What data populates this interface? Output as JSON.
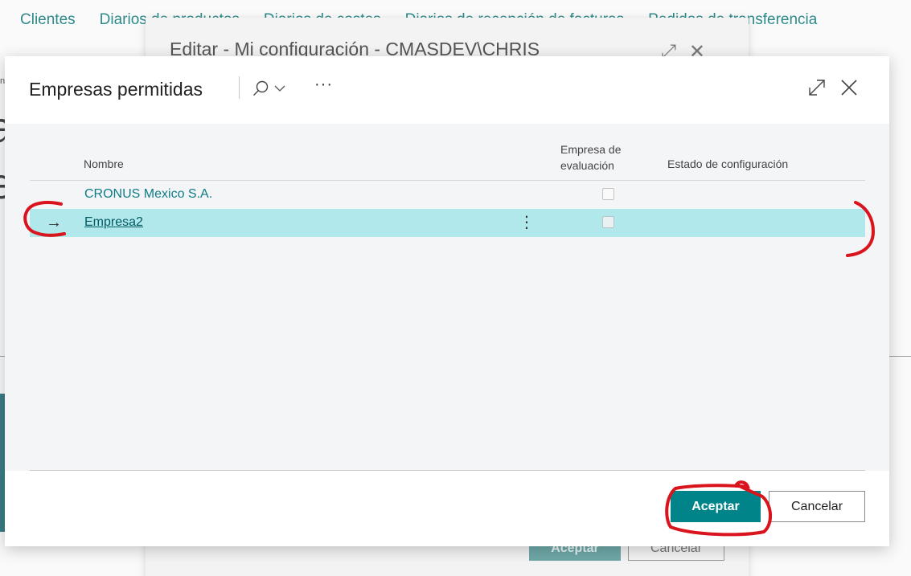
{
  "background": {
    "nav_items": [
      "Clientes",
      "Diarios",
      "Diarios de productos",
      "Diarios de costes",
      "Diarios de recepción de facturas",
      "Pedidos de transferencia"
    ],
    "edit_dialog": {
      "title": "Editar - Mi configuración - CMASDEV\\CHRIS",
      "accept_label": "Aceptar",
      "cancel_label": "Cancelar"
    }
  },
  "dialog": {
    "title": "Empresas permitidas",
    "columns": {
      "name": "Nombre",
      "evaluation": "Empresa de evaluación",
      "setup_status": "Estado de configuración"
    },
    "rows": [
      {
        "name": "CRONUS Mexico S.A.",
        "evaluation_company": false,
        "setup_status": ""
      },
      {
        "name": "Empresa2",
        "evaluation_company": false,
        "setup_status": "",
        "selected": true
      }
    ],
    "buttons": {
      "accept": "Aceptar",
      "cancel": "Cancelar"
    }
  },
  "colors": {
    "accent": "#008489",
    "selected_row": "#b0e8ec",
    "link": "#0e7c86",
    "annotation": "#d9141c"
  }
}
